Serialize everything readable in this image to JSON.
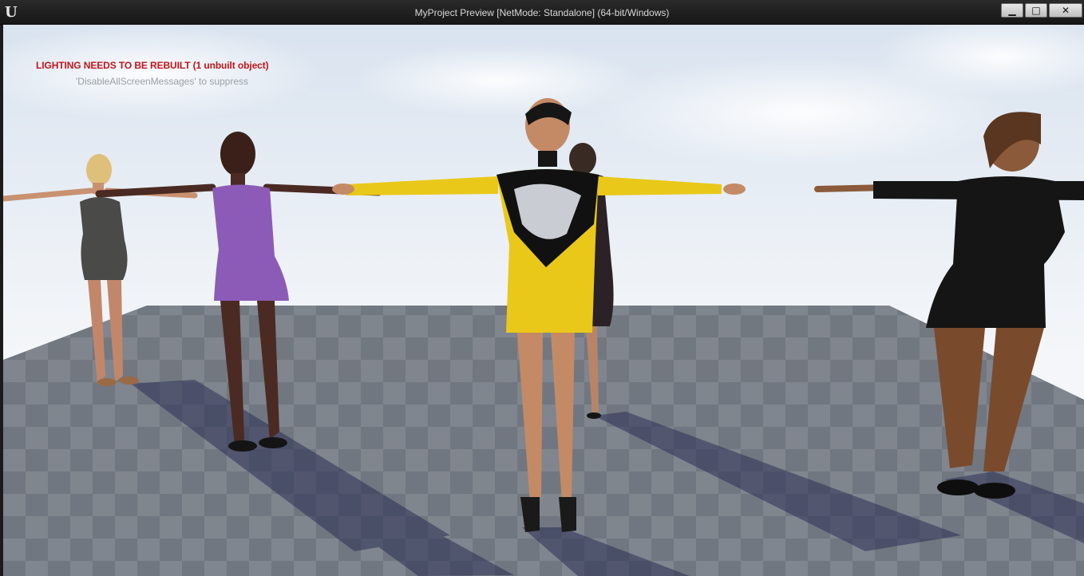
{
  "window": {
    "title": "MyProject Preview [NetMode: Standalone]  (64-bit/Windows)",
    "logo": "U",
    "controls": {
      "minimize": "▁",
      "maximize": "□",
      "close": "✕"
    }
  },
  "viewport": {
    "messages": {
      "lighting_warning": "LIGHTING NEEDS TO BE REBUILT (1 unbuilt object)",
      "suppress_hint": "'DisableAllScreenMessages' to suppress"
    },
    "characters": [
      {
        "label": "character-blonde",
        "outfit_color": "#4a4a48"
      },
      {
        "label": "character-purple-dress",
        "outfit_color": "#8c5bb8"
      },
      {
        "label": "character-yellow-dress",
        "outfit_color": "#e9c81a"
      },
      {
        "label": "character-dark-dress-back",
        "outfit_color": "#2a2226"
      },
      {
        "label": "character-black-dress",
        "outfit_color": "#151515"
      }
    ]
  },
  "colors": {
    "warning_red": "#c1131a",
    "hint_grey": "#9aa0a6",
    "titlebar": "#1f1f1f"
  }
}
